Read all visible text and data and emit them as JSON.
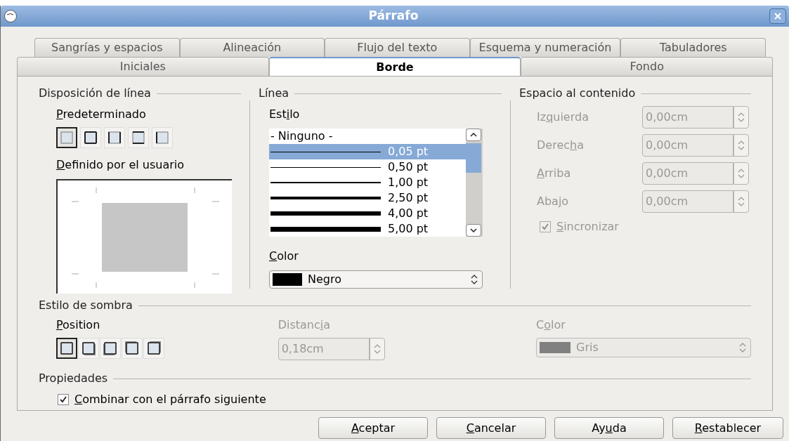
{
  "window": {
    "title": "Párrafo"
  },
  "tab_rows": [
    [
      {
        "label": "Sangrías y espacios",
        "selected": false
      },
      {
        "label": "Alineación",
        "selected": false
      },
      {
        "label": "Flujo del texto",
        "selected": false
      },
      {
        "label": "Esquema y numeración",
        "selected": false
      },
      {
        "label": "Tabuladores",
        "selected": false
      }
    ],
    [
      {
        "label": "Iniciales",
        "selected": false
      },
      {
        "label": "Borde",
        "selected": true
      },
      {
        "label": "Fondo",
        "selected": false
      }
    ]
  ],
  "line_arrangement": {
    "title": "Disposición de línea",
    "default_label": {
      "key": "P",
      "post": "redeterminado"
    },
    "presets": [
      {
        "selected": true
      },
      {
        "selected": false
      },
      {
        "selected": false
      },
      {
        "selected": false
      },
      {
        "selected": false
      }
    ],
    "user_defined_label": {
      "key": "D",
      "post": "efinido por el usuario"
    }
  },
  "line": {
    "title": "Línea",
    "style_label": {
      "pre": "Est",
      "key": "i",
      "post": "lo"
    },
    "styles": [
      {
        "label": "- Ninguno -",
        "selected": false,
        "kind": "none"
      },
      {
        "label": "0,05 pt",
        "selected": true,
        "kind": "hairline"
      },
      {
        "label": "0,50 pt",
        "selected": false,
        "kind": "hairline"
      },
      {
        "label": "1,00 pt",
        "selected": false,
        "kind": "thin"
      },
      {
        "label": "2,50 pt",
        "selected": false,
        "kind": "medium"
      },
      {
        "label": "4,00 pt",
        "selected": false,
        "kind": "thick"
      },
      {
        "label": "5,00 pt",
        "selected": false,
        "kind": "heavy"
      }
    ],
    "color_label": {
      "key": "C",
      "post": "olor"
    },
    "color": {
      "value": "Negro",
      "color": "#000000"
    }
  },
  "spacing": {
    "title": "Espacio al contenido",
    "fields": [
      {
        "label": {
          "pre": "Iz",
          "key": "q",
          "post": "uierda"
        },
        "value": "0,00cm",
        "disabled": true
      },
      {
        "label": {
          "pre": "Derec",
          "key": "h",
          "post": "a"
        },
        "value": "0,00cm",
        "disabled": true
      },
      {
        "label": {
          "key": "A",
          "post": "rriba"
        },
        "value": "0,00cm",
        "disabled": true
      },
      {
        "label": {
          "pre": "Aba",
          "key": "j",
          "post": "o"
        },
        "value": "0,00cm",
        "disabled": true
      }
    ],
    "synchronize": {
      "label": {
        "key": "S",
        "post": "incronizar"
      },
      "checked": true,
      "disabled": true
    }
  },
  "shadow": {
    "title": "Estilo de sombra",
    "position_label": {
      "key": "P",
      "post": "osition"
    },
    "positions": [
      {
        "selected": true
      },
      {
        "selected": false
      },
      {
        "selected": false
      },
      {
        "selected": false
      },
      {
        "selected": false
      }
    ],
    "distance_label": {
      "pre": "Distanc",
      "key": "i",
      "post": "a"
    },
    "distance": {
      "value": "0,18cm",
      "disabled": true
    },
    "color_label": {
      "pre": "C",
      "key": "o",
      "post": "lor"
    },
    "color": {
      "value": "Gris",
      "color": "#808080",
      "disabled": true
    }
  },
  "properties": {
    "title": "Propiedades",
    "merge": {
      "label": {
        "key": "C",
        "post": "ombinar con el párrafo siguiente"
      },
      "checked": true
    }
  },
  "buttons": [
    {
      "label": {
        "key": "A",
        "post": "ceptar"
      }
    },
    {
      "label": {
        "key": "C",
        "post": "ancelar"
      }
    },
    {
      "label": {
        "pre": "Ay",
        "key": "u",
        "post": "da"
      }
    },
    {
      "label": {
        "key": "R",
        "post": "establecer"
      }
    }
  ]
}
